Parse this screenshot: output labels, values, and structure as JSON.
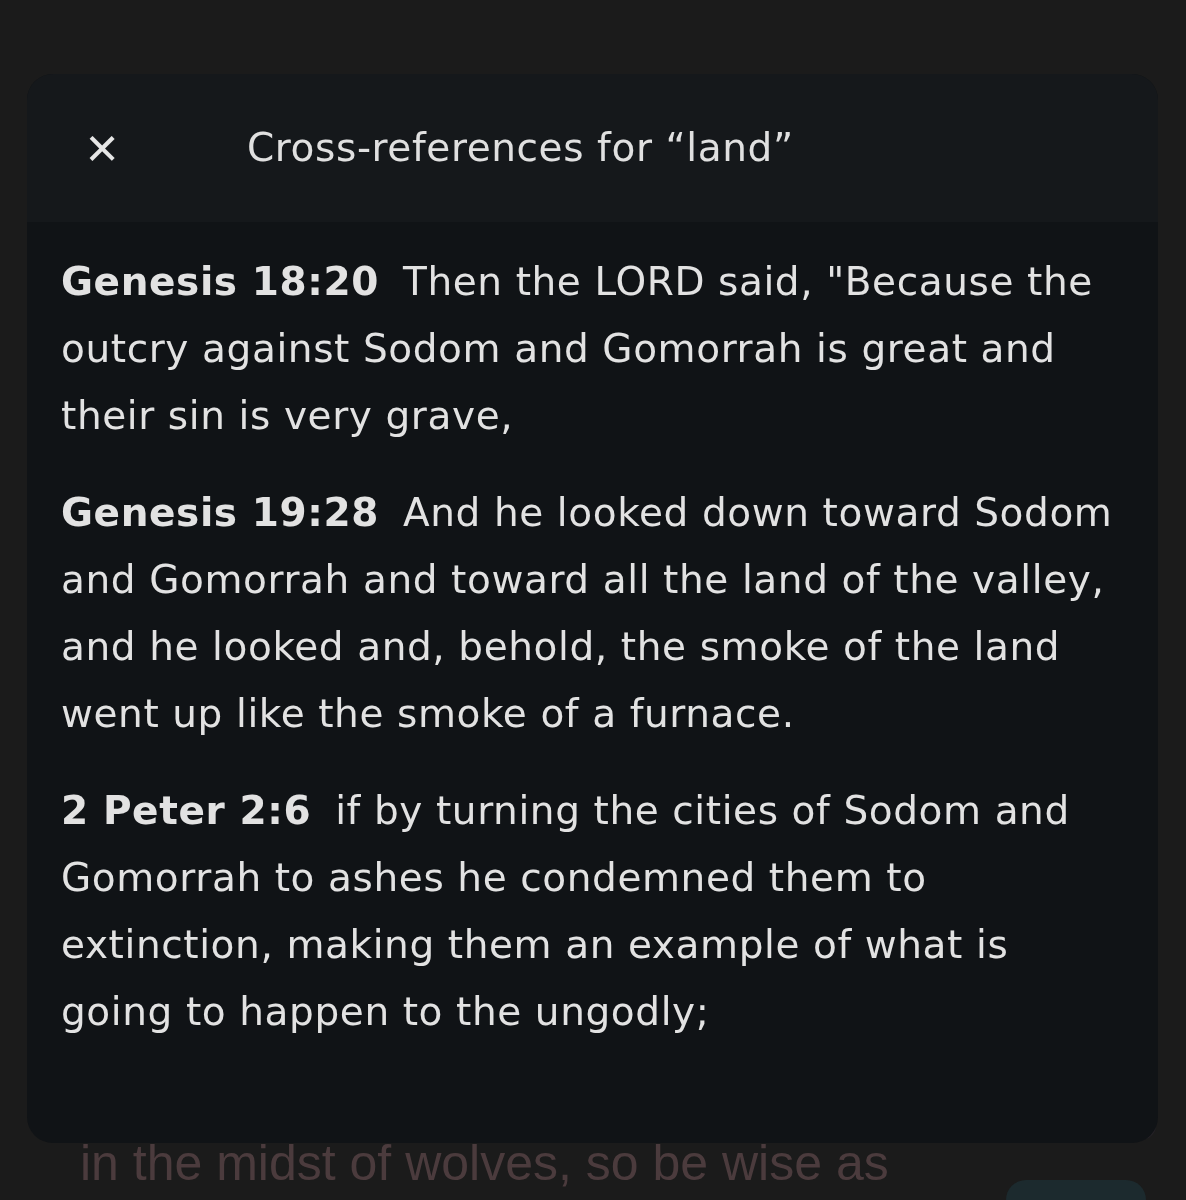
{
  "background_text": [
    {
      "text": "in the midst of wolves, so be wise as"
    }
  ],
  "dialog": {
    "close": "×",
    "title": "Cross-references for “land”",
    "references": [
      {
        "reference": "Genesis 18:20",
        "text": "Then the LORD said, \"Because the outcry against Sodom and Gomorrah is great and their sin is very grave,"
      },
      {
        "reference": "Genesis 19:28",
        "text": "And he looked down toward Sodom and Gomorrah and toward all the land of the valley, and he looked and, behold, the smoke of the land went up like the smoke of a furnace."
      },
      {
        "reference": "2 Peter 2:6",
        "text": "if by turning the cities of Sodom and Gomorrah to ashes he condemned them to extinction, making them an example of what is going to happen to the ungodly;"
      }
    ]
  }
}
